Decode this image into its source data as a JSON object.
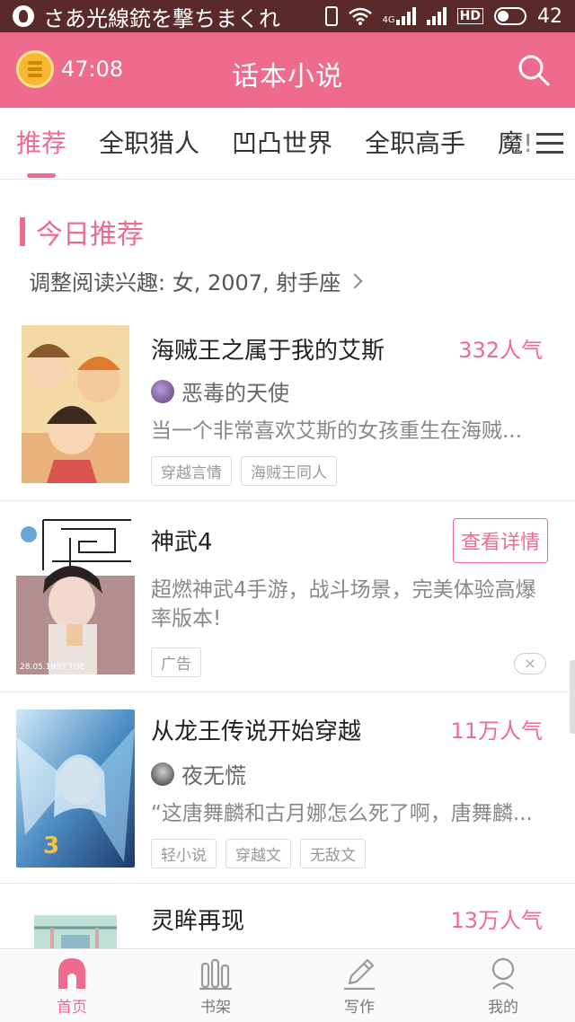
{
  "status_bar": {
    "left_text": "さあ光線銃を撃ちまくれ",
    "network": "4G",
    "hd": "HD",
    "battery": "42"
  },
  "header": {
    "timer": "47:08",
    "title": "话本小说"
  },
  "tabs": [
    {
      "label": "推荐"
    },
    {
      "label": "全职猎人"
    },
    {
      "label": "凹凸世界"
    },
    {
      "label": "全职高手"
    },
    {
      "label": "魔!"
    }
  ],
  "section": {
    "title": "今日推荐",
    "preference": "调整阅读兴趣: 女, 2007, 射手座"
  },
  "cards": [
    {
      "title": "海贼王之属于我的艾斯",
      "popularity": "332人气",
      "author": "恶毒的天使",
      "desc": "当一个非常喜欢艾斯的女孩重生在海贼...",
      "tags": [
        "穿越言情",
        "海贼王同人"
      ]
    },
    {
      "title": "神武4",
      "button": "查看详情",
      "desc": "超燃神武4手游，战斗场景，完美体验高爆率版本!",
      "tags": [
        "广告"
      ],
      "close": "×"
    },
    {
      "title": "从龙王传说开始穿越",
      "popularity": "11万人气",
      "author": "夜无慌",
      "desc": "“这唐舞麟和古月娜怎么死了啊，唐舞麟...",
      "tags": [
        "轻小说",
        "穿越文",
        "无敌文"
      ]
    },
    {
      "title": "灵眸再现",
      "popularity": "13万人气"
    }
  ],
  "bottom_nav": [
    {
      "label": "首页",
      "icon": "home-icon"
    },
    {
      "label": "书架",
      "icon": "bookshelf-icon"
    },
    {
      "label": "写作",
      "icon": "pen-icon"
    },
    {
      "label": "我的",
      "icon": "profile-icon"
    }
  ],
  "colors": {
    "accent": "#ef6b8e",
    "status_bar": "#5a2a2a"
  }
}
